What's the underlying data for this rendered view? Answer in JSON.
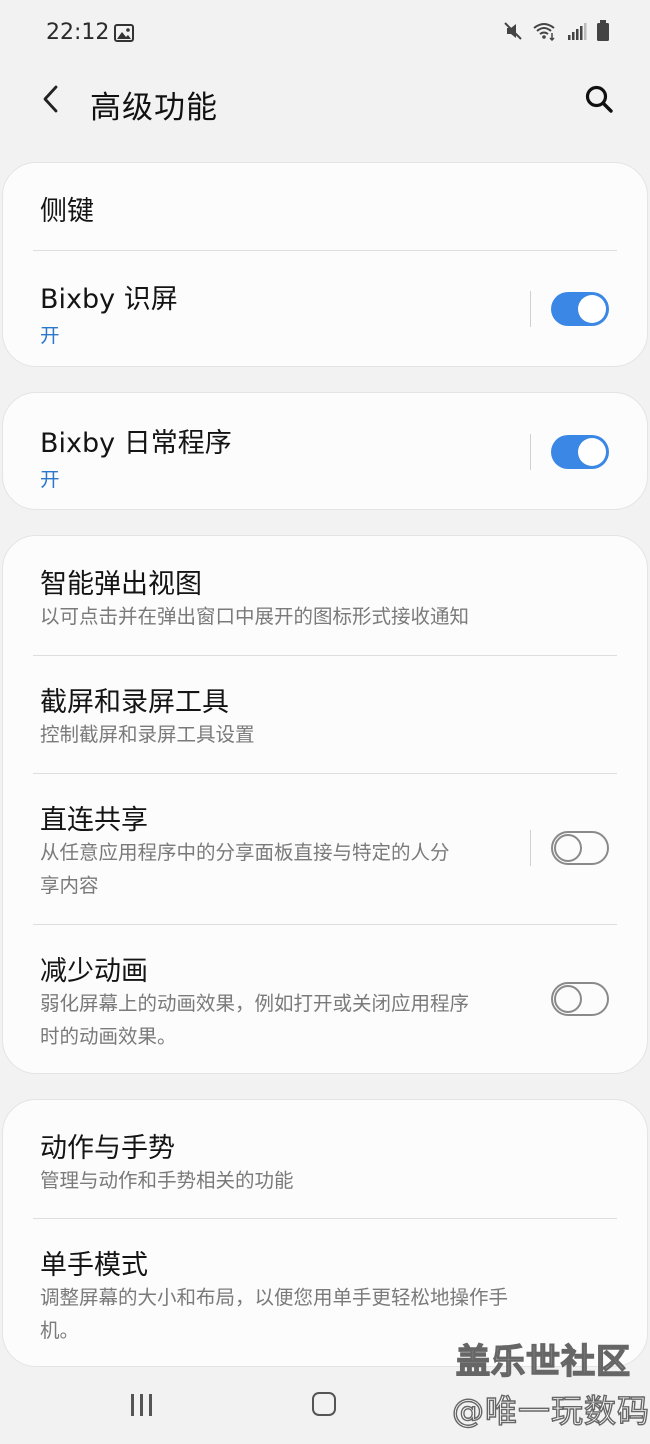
{
  "status_bar": {
    "time": "22:12",
    "icons": [
      "gallery-icon",
      "mute-icon",
      "wifi-icon",
      "signal-icon",
      "battery-icon"
    ]
  },
  "header": {
    "title": "高级功能"
  },
  "cards": {
    "side_key": {
      "title": "侧键"
    },
    "bixby_vision": {
      "title": "Bixby 识屏",
      "status": "开",
      "enabled": true
    },
    "bixby_routines": {
      "title": "Bixby 日常程序",
      "status": "开",
      "enabled": true
    },
    "smart_popup": {
      "title": "智能弹出视图",
      "subtitle": "以可点击并在弹出窗口中展开的图标形式接收通知"
    },
    "screenshot": {
      "title": "截屏和录屏工具",
      "subtitle": "控制截屏和录屏工具设置"
    },
    "direct_share": {
      "title": "直连共享",
      "subtitle_line1": "从任意应用程序中的分享面板直接与特定的人分",
      "subtitle_line2": "享内容",
      "enabled": false
    },
    "reduce_animations": {
      "title": "减少动画",
      "subtitle_line1": "弱化屏幕上的动画效果，例如打开或关闭应用程序",
      "subtitle_line2": "时的动画效果。",
      "enabled": false
    },
    "motions": {
      "title": "动作与手势",
      "subtitle": "管理与动作和手势相关的功能"
    },
    "one_hand": {
      "title": "单手模式",
      "subtitle_line1": "调整屏幕的大小和布局，以便您用单手更轻松地操作手",
      "subtitle_line2": "机。"
    }
  },
  "watermark": {
    "line1": "盖乐世社区",
    "line2": "@唯一玩数码"
  },
  "colors": {
    "accent": "#3a87e6",
    "status_on": "#2a78c9",
    "background": "#f2f2f2",
    "card": "#fcfcfc"
  }
}
